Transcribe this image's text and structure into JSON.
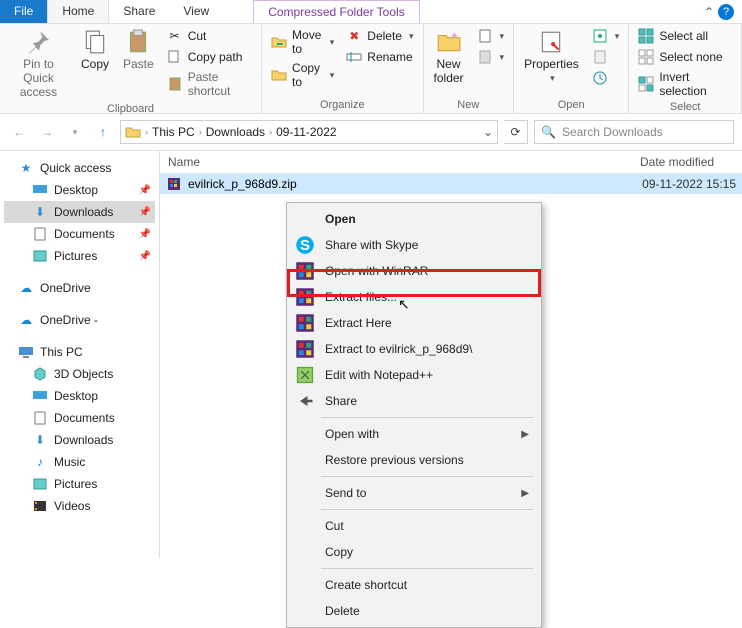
{
  "tabs": {
    "file": "File",
    "home": "Home",
    "share": "Share",
    "view": "View",
    "contextual": "Compressed Folder Tools"
  },
  "ribbon": {
    "clipboard": {
      "pin": "Pin to Quick\naccess",
      "copy": "Copy",
      "paste": "Paste",
      "cut": "Cut",
      "copypath": "Copy path",
      "pasteshortcut": "Paste shortcut",
      "label": "Clipboard"
    },
    "organize": {
      "moveto": "Move to",
      "copyto": "Copy to",
      "delete": "Delete",
      "rename": "Rename",
      "label": "Organize"
    },
    "new": {
      "newfolder": "New\nfolder",
      "label": "New"
    },
    "open": {
      "properties": "Properties",
      "label": "Open"
    },
    "select": {
      "all": "Select all",
      "none": "Select none",
      "invert": "Invert selection",
      "label": "Select"
    }
  },
  "address": {
    "seg1": "This PC",
    "seg2": "Downloads",
    "seg3": "09-11-2022",
    "search_placeholder": "Search Downloads"
  },
  "tree": {
    "quick": "Quick access",
    "desktop": "Desktop",
    "downloads": "Downloads",
    "documents": "Documents",
    "pictures": "Pictures",
    "onedrive1": "OneDrive",
    "onedrive2": "OneDrive -",
    "thispc": "This PC",
    "obj3d": "3D Objects",
    "desktop2": "Desktop",
    "documents2": "Documents",
    "downloads2": "Downloads",
    "music": "Music",
    "pictures2": "Pictures",
    "videos": "Videos"
  },
  "columns": {
    "name": "Name",
    "date": "Date modified"
  },
  "file": {
    "name": "evilrick_p_968d9.zip",
    "date": "09-11-2022 15:15"
  },
  "ctx": {
    "open": "Open",
    "skype": "Share with Skype",
    "openwr": "Open with WinRAR",
    "extractfiles": "Extract files...",
    "extracthere": "Extract Here",
    "extractto": "Extract to evilrick_p_968d9\\",
    "notepad": "Edit with Notepad++",
    "share": "Share",
    "openwith": "Open with",
    "restore": "Restore previous versions",
    "sendto": "Send to",
    "cut": "Cut",
    "copy": "Copy",
    "shortcut": "Create shortcut",
    "delete": "Delete"
  }
}
